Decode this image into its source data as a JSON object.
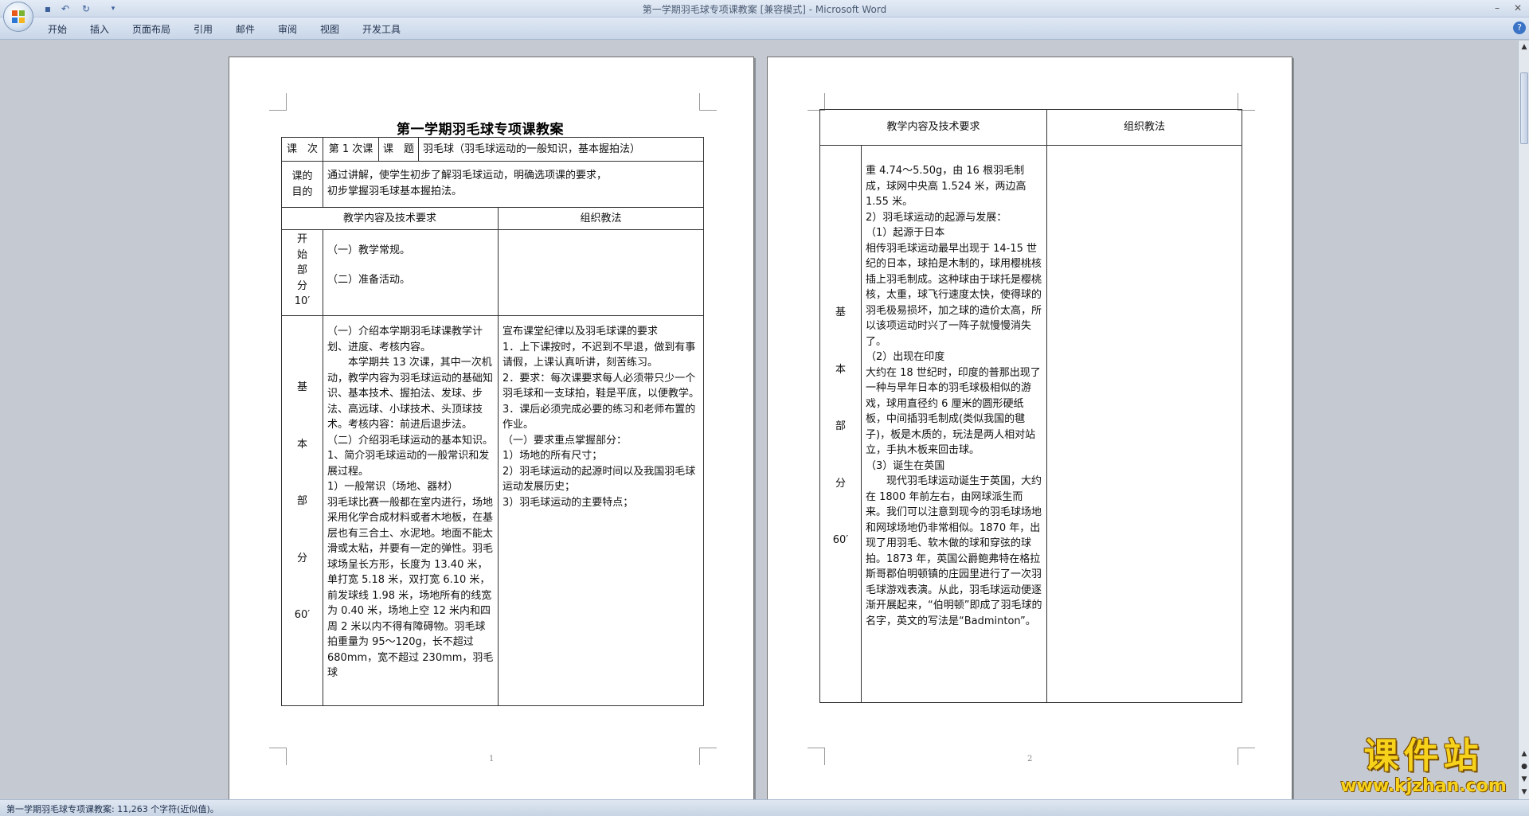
{
  "window": {
    "title": "第一学期羽毛球专项课教案 [兼容模式] - Microsoft Word",
    "quick_access": [
      "save-icon",
      "undo-icon",
      "redo-icon",
      "customize-icon"
    ],
    "controls": {
      "minimize": "–",
      "maximize": "□",
      "close": "✕"
    }
  },
  "ribbon": {
    "tabs": [
      "开始",
      "插入",
      "页面布局",
      "引用",
      "邮件",
      "审阅",
      "视图",
      "开发工具"
    ],
    "help": "?"
  },
  "colors": {
    "ribbon": "#d4dfee",
    "workspace": "#c5cad2",
    "watermark": "#f7d21a"
  },
  "page1": {
    "title": "第一学期羽毛球专项课教案",
    "row1": {
      "k1": "课　次",
      "v1": "第 1 次课",
      "k2": "课　题",
      "v2": "羽毛球（羽毛球运动的一般知识，基本握拍法）"
    },
    "purpose": {
      "label": "课的目的",
      "text1": "通过讲解，使学生初步了解羽毛球运动，明确选项课的要求，",
      "text2": "初步掌握羽毛球基本握拍法。"
    },
    "header": {
      "content": "教学内容及技术要求",
      "method": "组织教法"
    },
    "start": {
      "label": [
        "开",
        "始",
        "部",
        "分",
        "10′"
      ],
      "items": [
        "（一）教学常规。",
        "（二）准备活动。"
      ]
    },
    "basic": {
      "label": [
        "基",
        "本",
        "部",
        "分",
        "60′"
      ],
      "content": [
        "（一）介绍本学期羽毛球课教学计划、进度、考核内容。",
        "本学期共 13 次课，其中一次机动，教学内容为羽毛球运动的基础知识、基本技术、握拍法、发球、步法、高远球、小球技术、头顶球技术。考核内容：前进后退步法。",
        "（二）介绍羽毛球运动的基本知识。",
        "1、简介羽毛球运动的一般常识和发展过程。",
        "1）一般常识（场地、器材）",
        "羽毛球比赛一般都在室内进行，场地采用化学合成材料或者木地板，在基层也有三合土、水泥地。地面不能太滑或太粘，并要有一定的弹性。羽毛球场呈长方形，长度为 13.40 米，单打宽 5.18 米，双打宽 6.10 米，前发球线 1.98 米，场地所有的线宽为 0.40 米，场地上空 12 米内和四周 2 米以内不得有障碍物。羽毛球拍重量为 95～120g，长不超过 680mm，宽不超过 230mm，羽毛球"
      ],
      "method": [
        "宣布课堂纪律以及羽毛球课的要求",
        "1．上下课按时，不迟到不早退，做到有事请假，上课认真听讲，刻苦练习。",
        "2．要求：每次课要求每人必须带只少一个羽毛球和一支球拍，鞋是平底，以便教学。",
        "3．课后必须完成必要的练习和老师布置的作业。",
        "（一）要求重点掌握部分：",
        "1）场地的所有尺寸；",
        "2）羽毛球运动的起源时间以及我国羽毛球运动发展历史；",
        "3）羽毛球运动的主要特点；"
      ]
    },
    "page_number": "1"
  },
  "page2": {
    "header": {
      "content": "教学内容及技术要求",
      "method": "组织教法"
    },
    "label": [
      "基",
      "本",
      "部",
      "分",
      "60′"
    ],
    "content": [
      "重 4.74～5.50g，由 16 根羽毛制成，球网中央高 1.524 米，两边高 1.55 米。",
      "2）羽毛球运动的起源与发展：",
      "（1）起源于日本",
      "相传羽毛球运动最早出现于 14-15 世纪的日本，球拍是木制的，球用樱桃核插上羽毛制成。这种球由于球托是樱桃核，太重，球飞行速度太快，使得球的羽毛极易损坏，加之球的造价太高，所以该项运动时兴了一阵子就慢慢消失了。",
      "（2）出现在印度",
      "大约在 18 世纪时，印度的普那出现了一种与早年日本的羽毛球极相似的游戏，球用直径约 6 厘米的圆形硬纸板，中间插羽毛制成(类似我国的毽子)，板是木质的，玩法是两人相对站立，手执木板来回击球。",
      "（3）诞生在英国",
      "现代羽毛球运动诞生于英国，大约在 1800 年前左右，由网球派生而来。我们可以注意到现今的羽毛球场地和网球场地仍非常相似。1870 年，出现了用羽毛、软木做的球和穿弦的球拍。1873 年，英国公爵鲍弗特在格拉斯哥郡伯明顿镇的庄园里进行了一次羽毛球游戏表演。从此，羽毛球运动便逐渐开展起来，“伯明顿”即成了羽毛球的名字，英文的写法是“Badminton”。"
    ],
    "page_number": "2"
  },
  "status": {
    "text": "第一学期羽毛球专项课教案: 11,263 个字符(近似值)。"
  },
  "watermark": {
    "big": "课件站",
    "url": "www.kjzhan.com"
  }
}
